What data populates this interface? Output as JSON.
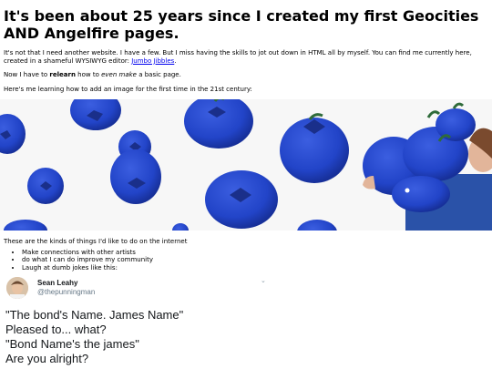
{
  "heading": "It's been about 25 years since I created my first Geocities AND Angelfire pages.",
  "intro": {
    "text": "It's not that I need another website. I have a few. But I miss having the skills to jot out down in HTML all by myself. You can find me currently here, created in a shameful WYSIWYG editor: ",
    "link_text": "Jumbo Jibbles",
    "after_link": "."
  },
  "relearn": {
    "before": "Now I have to ",
    "bold": "relearn",
    "middle": " how to ",
    "italic": "even make",
    "after": " a basic page."
  },
  "image_intro": "Here's me learning how to add an image for the first time in the 21st century:",
  "hero_image": {
    "background": "#f7f7f7",
    "berry_color": "#2244c8",
    "leaf_color": "#2f6b3a",
    "shirt_color": "#2a52a8"
  },
  "list_intro": "These are the kinds of things I'd like to do on the internet",
  "list_items": [
    "Make connections with other artists",
    "do what I can do improve my community",
    "Laugh at dumb jokes like this:"
  ],
  "tweet": {
    "name": "Sean Leahy",
    "handle": "@thepunningman",
    "chevron_icon": "chevron-down-icon",
    "lines": [
      "\"The bond's Name. James Name\"",
      "Pleased to... what?",
      "\"Bond Name's the james\"",
      "Are you alright?"
    ]
  }
}
